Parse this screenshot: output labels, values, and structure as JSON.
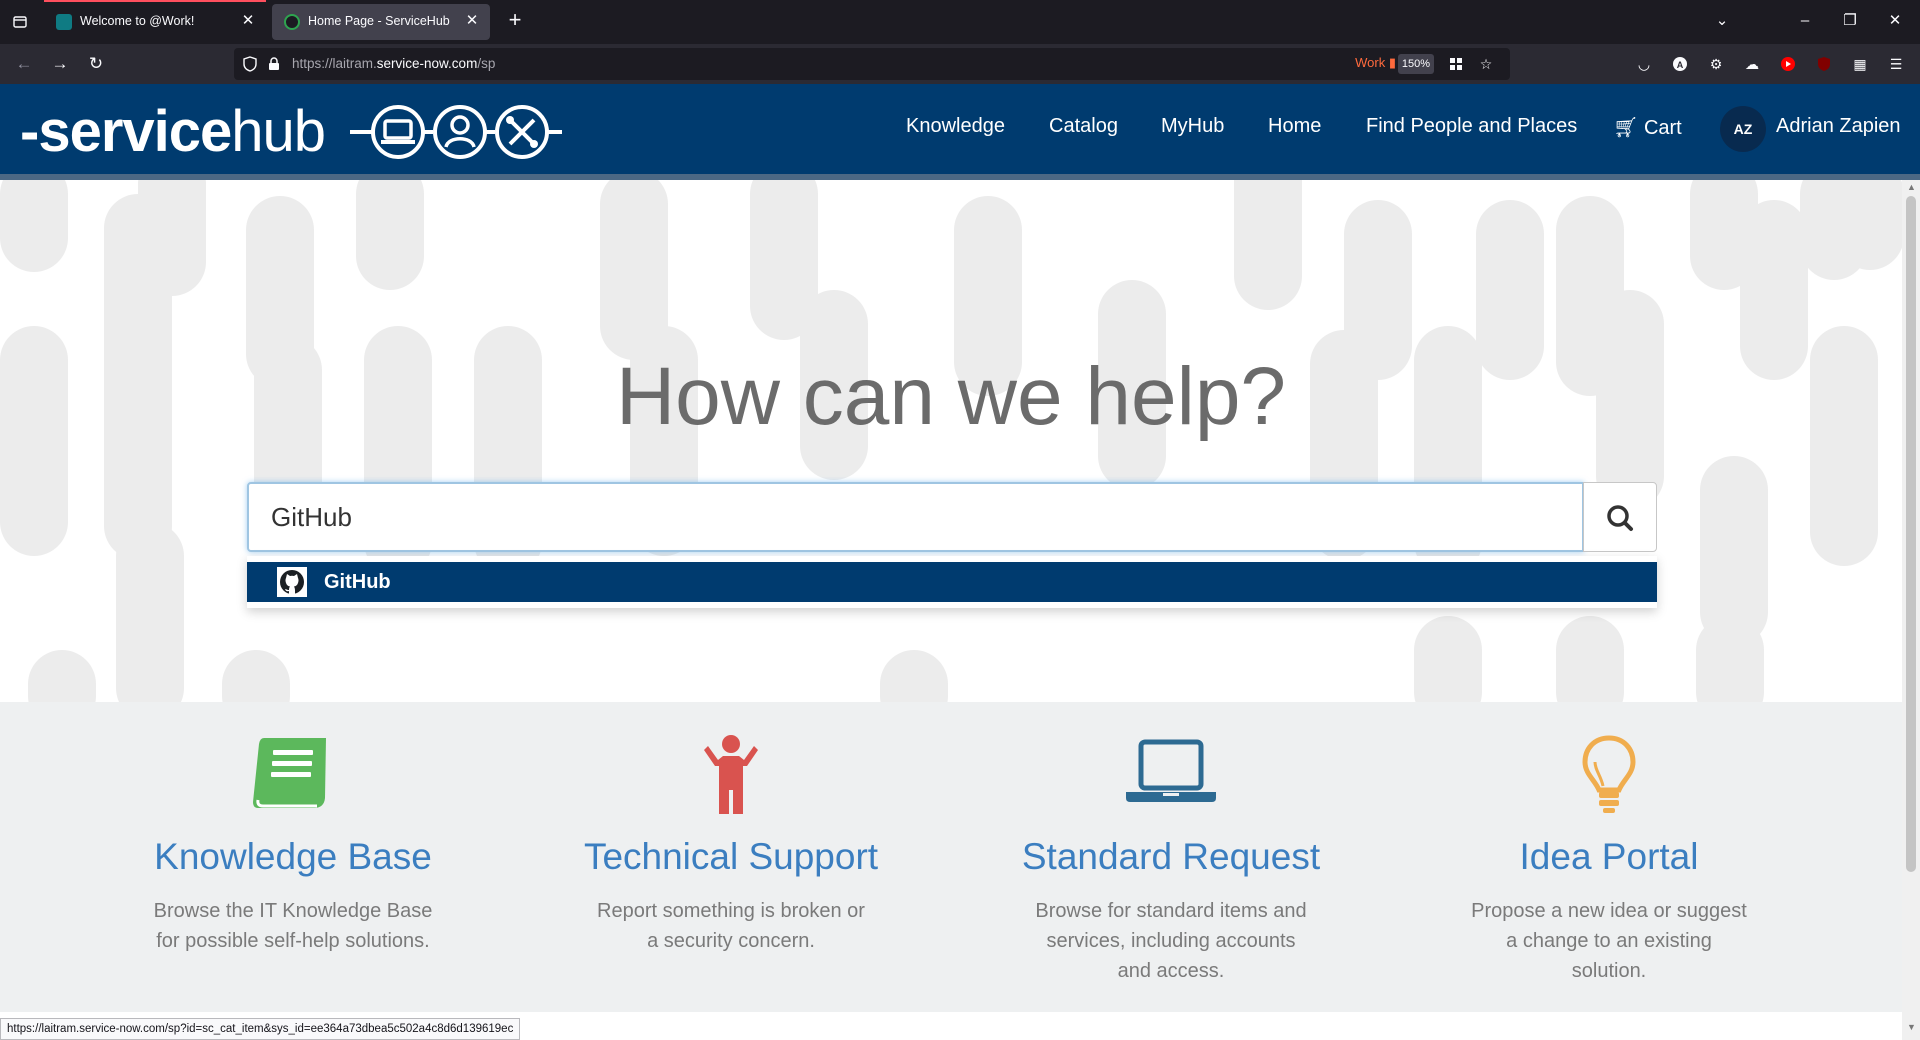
{
  "browser": {
    "tabs": [
      {
        "title": "Welcome to @Work!",
        "active": false,
        "favicon_color": "#0f7b83",
        "accent": "#ff4f5e"
      },
      {
        "title": "Home Page - ServiceHub",
        "active": true,
        "favicon_color": "#2ea44f",
        "accent": "#42414d"
      }
    ],
    "url_prefix": "https://laitram.",
    "url_domain": "service-now.com",
    "url_path": "/sp",
    "container": "Work",
    "zoom": "150%",
    "status_url": "https://laitram.service-now.com/sp?id=sc_cat_item&sys_id=ee364a73dbea5c502a4c8d6d139619ec"
  },
  "header": {
    "logo_prefix": "-service",
    "logo_suffix": "hub",
    "nav": [
      "Knowledge",
      "Catalog",
      "MyHub",
      "Home",
      "Find People and Places",
      "Cart"
    ],
    "user_initials": "AZ",
    "user_name": "Adrian Zapien",
    "brand_color": "#003b6f"
  },
  "hero": {
    "title": "How can we help?",
    "search_value": "GitHub",
    "suggestions": [
      {
        "label": "GitHub",
        "icon": "github-icon"
      }
    ]
  },
  "cards": [
    {
      "title": "Knowledge Base",
      "description": "Browse the IT Knowledge Base for possible self-help solutions.",
      "icon": "book-icon",
      "color": "#5cb85c"
    },
    {
      "title": "Technical Support",
      "description": "Report something is broken or a security concern.",
      "icon": "person-icon",
      "color": "#d9534f"
    },
    {
      "title": "Standard Request",
      "description": "Browse for standard items and services, including accounts and access.",
      "icon": "laptop-icon",
      "color": "#2d6a92"
    },
    {
      "title": "Idea Portal",
      "description": "Propose a new idea or suggest a change to an existing solution.",
      "icon": "lightbulb-icon",
      "color": "#f0ad4e"
    }
  ]
}
